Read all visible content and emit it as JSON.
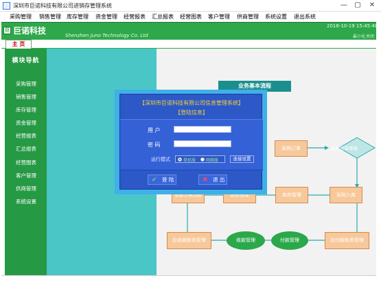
{
  "window": {
    "title": "深圳市巨诺科技有限公司进销存管理系统",
    "controls": {
      "minimize": "—",
      "maximize": "▢",
      "close": "✕"
    }
  },
  "menu": [
    "采购管理",
    "销售管理",
    "库存管理",
    "资金管理",
    "经营报表",
    "汇总报表",
    "经营图表",
    "客户管理",
    "供商管理",
    "系统设置",
    "退出系统"
  ],
  "header": {
    "logo": "巨",
    "company_cn": "巨诺科技",
    "company_en": "Shenzhen Juno Technology Co. Ltd",
    "datetime": "2018-10-19 15:45:48",
    "buttons": [
      "最小化",
      "关闭"
    ]
  },
  "tabs": {
    "home": "主 页"
  },
  "sidebar": {
    "title": "模块导航",
    "items": [
      "采购管理",
      "销售管理",
      "库存管理",
      "资金管理",
      "经营报表",
      "汇总报表",
      "经营图表",
      "客户管理",
      "供商管理",
      "系统设置"
    ]
  },
  "flow": {
    "title": "业务基本流程",
    "nodes": {
      "purchase_order": "采购订单",
      "purchase_review": "采购订单审核",
      "purchase_in": "采购入库",
      "stock": "库存管理",
      "sales_out": "销售出库",
      "sales_done": "销售订单完成",
      "receivable": "应收款账务管理",
      "collect": "收款管理",
      "pay": "付款管理",
      "payable": "应付款账务管理"
    }
  },
  "login": {
    "title": "【深圳市巨诺科技有限公司信息管理系统】",
    "subtitle": "【登陆信息】",
    "user_label": "用  户",
    "password_label": "密  码",
    "user_value": "",
    "password_value": "",
    "mode_label": "运行模式",
    "mode_options": [
      "单机版",
      "网络版"
    ],
    "mode_selected": "单机版",
    "connect_button": "连接设置",
    "login_button": "登 陆",
    "exit_button": "退 出",
    "colors": {
      "dialog": "#2c58c8",
      "title_text": "#f6d23a",
      "frame": "#3fb0e8"
    }
  },
  "colors": {
    "header_green": "#2ea84a",
    "sidebar_green": "#259944",
    "teal": "#4ac6c6",
    "flow_box": "#f7c89a",
    "flow_oval": "#2ba84a"
  }
}
